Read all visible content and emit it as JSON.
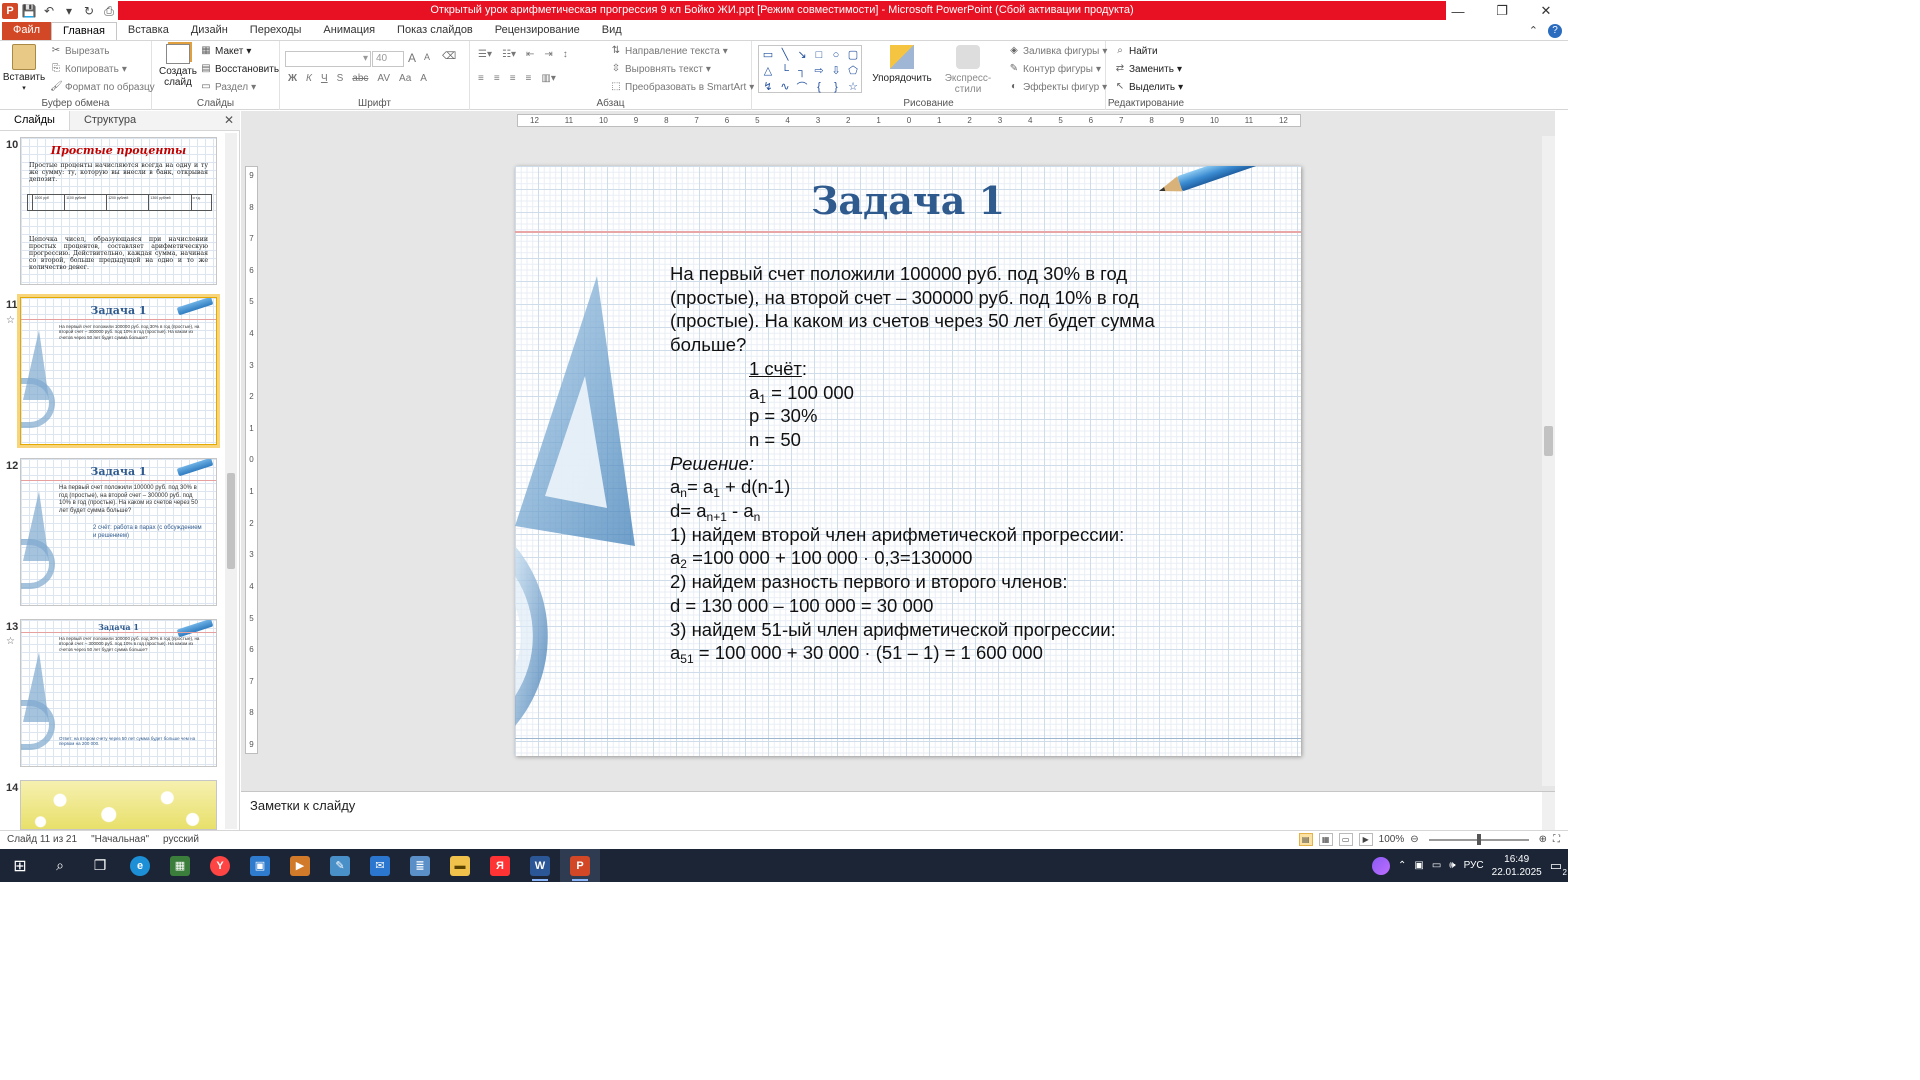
{
  "window": {
    "title": "Открытый урок арифметическая прогрессия 9 кл Бойко ЖИ.ppt [Режим совместимости]  -  Microsoft PowerPoint (Сбой активации продукта)",
    "app_logo": "P",
    "controls": {
      "minimize": "—",
      "restore": "❐",
      "close": "✕"
    }
  },
  "ribbon_tabs": [
    "Файл",
    "Главная",
    "Вставка",
    "Дизайн",
    "Переходы",
    "Анимация",
    "Показ слайдов",
    "Рецензирование",
    "Вид"
  ],
  "ribbon": {
    "clipboard": {
      "paste": "Вставить",
      "cut": "Вырезать",
      "copy": "Копировать",
      "format_painter": "Формат по образцу",
      "label": "Буфер обмена"
    },
    "slides": {
      "new_slide": "Создать слайд",
      "layout": "Макет",
      "reset": "Восстановить",
      "section": "Раздел",
      "label": "Слайды"
    },
    "font": {
      "size": "40",
      "label": "Шрифт",
      "bold": "Ж",
      "italic": "К",
      "underline": "Ч",
      "shadow": "S",
      "strike": "abc",
      "spacing": "AV",
      "case": "Aa",
      "color": "A",
      "grow": "A",
      "shrink": "A"
    },
    "paragraph": {
      "text_direction": "Направление текста",
      "align_text": "Выровнять текст",
      "smartart": "Преобразовать в SmartArt",
      "label": "Абзац"
    },
    "drawing": {
      "arrange": "Упорядочить",
      "quick_styles": "Экспресс-стили",
      "fill": "Заливка фигуры",
      "outline": "Контур фигуры",
      "effects": "Эффекты фигур",
      "label": "Рисование"
    },
    "editing": {
      "find": "Найти",
      "replace": "Заменить",
      "select": "Выделить",
      "label": "Редактирование"
    }
  },
  "left_pane": {
    "tabs": [
      "Слайды",
      "Структура"
    ],
    "close": "✕",
    "thumbnails": [
      {
        "num": "10",
        "title": "Простые проценты",
        "intro": "Простые проценты начисляются всегда на одну и ту же сумму: ту, которую вы внесли в банк, открывая депозит.",
        "body": "Цепочка чисел, образующаяся при начислении простых процентов, составляет арифметическую прогрессию. Действительно, каждая сумма, начиная со второй, больше предыдущей на одно и то же количество денег.",
        "cells": [
          "1000 руб",
          "1100 рублей",
          "1200 рублей",
          "1300 рублей",
          "и т.д."
        ]
      },
      {
        "num": "11",
        "title": "Задача 1",
        "selected": true
      },
      {
        "num": "12",
        "title": "Задача 1",
        "text": "На первый счет положили 100000 руб. под 30% в год (простые), на второй счет – 300000 руб. под 10% в год (простые). На каком из счетов через 50 лет будет сумма больше?",
        "note": "2 счёт: работа в парах (с обсуждением и решением)"
      },
      {
        "num": "13",
        "title": "Задача 1",
        "answer": "Ответ: на втором счету через 50 лет сумма будет больше чем на первом на 200 000."
      },
      {
        "num": "14"
      }
    ]
  },
  "ruler": {
    "h_ticks": [
      "12",
      "11",
      "10",
      "9",
      "8",
      "7",
      "6",
      "5",
      "4",
      "3",
      "2",
      "1",
      "0",
      "1",
      "2",
      "3",
      "4",
      "5",
      "6",
      "7",
      "8",
      "9",
      "10",
      "11",
      "12"
    ],
    "v_ticks": [
      "9",
      "8",
      "7",
      "6",
      "5",
      "4",
      "3",
      "2",
      "1",
      "0",
      "1",
      "2",
      "3",
      "4",
      "5",
      "6",
      "7",
      "8",
      "9"
    ]
  },
  "slide": {
    "title": "Задача 1",
    "problem": "На первый счет положили 100000 руб. под 30% в год (простые), на второй счет – 300000 руб. под 10% в год (простые). На каком из счетов через 50 лет будет сумма больше?",
    "given_header": "1 счёт",
    "given_a1": "= 100 000",
    "given_p": "p = 30%",
    "given_n": "n = 50",
    "solution_label": "Решение:",
    "formula1": "= a",
    "formula1_tail": " + d(n-1)",
    "formula2": "d= a",
    "step1": "1) найдем второй член арифметической прогрессии:",
    "step1_calc": " =100 000 + 100 000 · 0,3=130000",
    "step2": "2) найдем разность первого и второго членов:",
    "step2_calc": "d = 130 000 – 100 000 = 30 000",
    "step3": "3) найдем 51-ый член арифметической прогрессии:",
    "step3_calc": " = 100 000 + 30 000 · (51 – 1) = 1 600 000"
  },
  "notes_placeholder": "Заметки к слайду",
  "status": {
    "slide_counter": "Слайд 11 из 21",
    "theme": "\"Начальная\"",
    "language": "русский",
    "zoom": "100%"
  },
  "taskbar": {
    "lang": "РУС",
    "time": "16:49",
    "date": "22.01.2025",
    "notification_count": "2"
  }
}
